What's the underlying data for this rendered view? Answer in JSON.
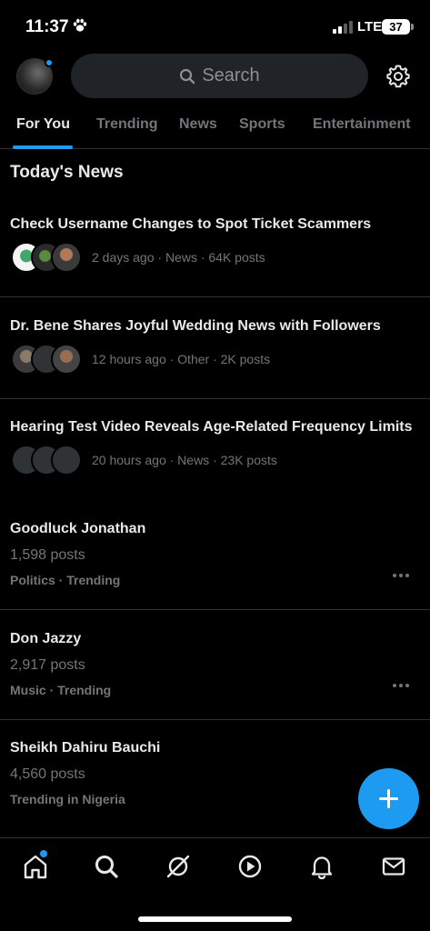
{
  "status_bar": {
    "time": "11:37",
    "network": "LTE",
    "battery": "37"
  },
  "header": {
    "search_placeholder": "Search"
  },
  "tabs": [
    {
      "label": "For You",
      "active": true
    },
    {
      "label": "Trending",
      "active": false
    },
    {
      "label": "News",
      "active": false
    },
    {
      "label": "Sports",
      "active": false
    },
    {
      "label": "Entertainment",
      "active": false
    }
  ],
  "section_title": "Today's News",
  "news": [
    {
      "title": "Check Username Changes to Spot Ticket Scammers",
      "meta": "2 days ago · News · 64K posts"
    },
    {
      "title": "Dr. Bene Shares Joyful Wedding News with Followers",
      "meta": "12 hours ago · Other · 2K posts"
    },
    {
      "title": "Hearing Test Video Reveals Age-Related Frequency Limits",
      "meta": "20 hours ago · News · 23K posts"
    }
  ],
  "trends": [
    {
      "name": "Goodluck Jonathan",
      "count": "1,598 posts",
      "category": "Politics · Trending"
    },
    {
      "name": "Don Jazzy",
      "count": "2,917 posts",
      "category": "Music · Trending"
    },
    {
      "name": "Sheikh Dahiru Bauchi",
      "count": "4,560 posts",
      "category": "Trending in Nigeria"
    }
  ],
  "bottom_nav": [
    "home-icon",
    "search-icon",
    "grok-icon",
    "video-icon",
    "notifications-icon",
    "messages-icon"
  ],
  "colors": {
    "accent": "#1d9bf0",
    "background": "#000000",
    "secondary_text": "#71767b",
    "divider": "#2f3336"
  }
}
